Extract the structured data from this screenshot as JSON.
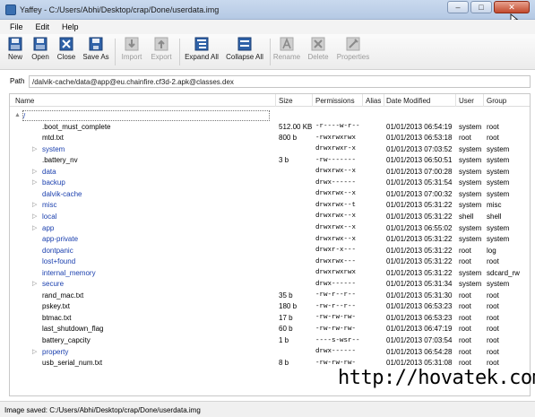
{
  "window": {
    "title": "Yaffey - C:/Users/Abhi/Desktop/crap/Done/userdata.img",
    "minimize_label": "–",
    "maximize_label": "□",
    "close_label": "✕"
  },
  "menu": {
    "items": [
      "File",
      "Edit",
      "Help"
    ]
  },
  "toolbar": {
    "buttons": [
      {
        "label": "New",
        "icon": "new-file-icon",
        "enabled": true
      },
      {
        "label": "Open",
        "icon": "open-icon",
        "enabled": true
      },
      {
        "label": "Close",
        "icon": "close-file-icon",
        "enabled": true
      },
      {
        "label": "Save As",
        "icon": "save-as-icon",
        "enabled": true
      },
      {
        "label": "Import",
        "icon": "import-icon",
        "enabled": false
      },
      {
        "label": "Export",
        "icon": "export-icon",
        "enabled": false
      },
      {
        "label": "Expand All",
        "icon": "expand-all-icon",
        "enabled": true
      },
      {
        "label": "Collapse All",
        "icon": "collapse-all-icon",
        "enabled": true
      },
      {
        "label": "Rename",
        "icon": "rename-icon",
        "enabled": false
      },
      {
        "label": "Delete",
        "icon": "delete-icon",
        "enabled": false
      },
      {
        "label": "Properties",
        "icon": "properties-icon",
        "enabled": false
      }
    ]
  },
  "path": {
    "label": "Path",
    "value": "/dalvik-cache/data@app@eu.chainfire.cf3d-2.apk@classes.dex"
  },
  "table": {
    "columns": [
      "Name",
      "Size",
      "Permissions",
      "Alias",
      "Date Modified",
      "User",
      "Group"
    ],
    "rows": [
      {
        "name": "/",
        "type": "root",
        "expander": "▲",
        "size": "",
        "perm": "",
        "date": "",
        "user": "",
        "group": ""
      },
      {
        "name": ".boot_must_complete",
        "type": "file",
        "size": "512.00 KB",
        "perm": "-r----w-r--",
        "date": "01/01/2013 06:54:19",
        "user": "system",
        "group": "root"
      },
      {
        "name": "mtd.txt",
        "type": "file",
        "size": "800 b",
        "perm": "-rwxrwxrwx",
        "date": "01/01/2013 06:53:18",
        "user": "root",
        "group": "root"
      },
      {
        "name": "system",
        "type": "dir",
        "expander": "▷",
        "size": "",
        "perm": "drwxrwxr-x",
        "date": "01/01/2013 07:03:52",
        "user": "system",
        "group": "system"
      },
      {
        "name": ".battery_nv",
        "type": "file",
        "size": "3 b",
        "perm": "-rw-------",
        "date": "01/01/2013 06:50:51",
        "user": "system",
        "group": "system"
      },
      {
        "name": "data",
        "type": "dir",
        "expander": "▷",
        "size": "",
        "perm": "drwxrwx--x",
        "date": "01/01/2013 07:00:28",
        "user": "system",
        "group": "system"
      },
      {
        "name": "backup",
        "type": "dir",
        "expander": "▷",
        "size": "",
        "perm": "drwx------",
        "date": "01/01/2013 05:31:54",
        "user": "system",
        "group": "system"
      },
      {
        "name": "dalvik-cache",
        "type": "dir",
        "size": "",
        "perm": "drwxrwx--x",
        "date": "01/01/2013 07:00:32",
        "user": "system",
        "group": "system"
      },
      {
        "name": "misc",
        "type": "dir",
        "expander": "▷",
        "size": "",
        "perm": "drwxrwx--t",
        "date": "01/01/2013 05:31:22",
        "user": "system",
        "group": "misc"
      },
      {
        "name": "local",
        "type": "dir",
        "expander": "▷",
        "size": "",
        "perm": "drwxrwx--x",
        "date": "01/01/2013 05:31:22",
        "user": "shell",
        "group": "shell"
      },
      {
        "name": "app",
        "type": "dir",
        "expander": "▷",
        "size": "",
        "perm": "drwxrwx--x",
        "date": "01/01/2013 06:55:02",
        "user": "system",
        "group": "system"
      },
      {
        "name": "app-private",
        "type": "dir",
        "size": "",
        "perm": "drwxrwx--x",
        "date": "01/01/2013 05:31:22",
        "user": "system",
        "group": "system"
      },
      {
        "name": "dontpanic",
        "type": "dir",
        "size": "",
        "perm": "drwxr-x---",
        "date": "01/01/2013 05:31:22",
        "user": "root",
        "group": "log"
      },
      {
        "name": "lost+found",
        "type": "dir",
        "size": "",
        "perm": "drwxrwx---",
        "date": "01/01/2013 05:31:22",
        "user": "root",
        "group": "root"
      },
      {
        "name": "internal_memory",
        "type": "dir",
        "size": "",
        "perm": "drwxrwxrwx",
        "date": "01/01/2013 05:31:22",
        "user": "system",
        "group": "sdcard_rw"
      },
      {
        "name": "secure",
        "type": "dir",
        "expander": "▷",
        "size": "",
        "perm": "drwx------",
        "date": "01/01/2013 05:31:34",
        "user": "system",
        "group": "system"
      },
      {
        "name": "rand_mac.txt",
        "type": "file",
        "size": "35 b",
        "perm": "-rw-r--r--",
        "date": "01/01/2013 05:31:30",
        "user": "root",
        "group": "root"
      },
      {
        "name": "pskey.txt",
        "type": "file",
        "size": "180 b",
        "perm": "-rw-r--r--",
        "date": "01/01/2013 06:53:23",
        "user": "root",
        "group": "root"
      },
      {
        "name": "btmac.txt",
        "type": "file",
        "size": "17 b",
        "perm": "-rw-rw-rw-",
        "date": "01/01/2013 06:53:23",
        "user": "root",
        "group": "root"
      },
      {
        "name": "last_shutdown_flag",
        "type": "file",
        "size": "60 b",
        "perm": "-rw-rw-rw-",
        "date": "01/01/2013 06:47:19",
        "user": "root",
        "group": "root"
      },
      {
        "name": "battery_capcity",
        "type": "file",
        "size": "1 b",
        "perm": "----s-wsr--",
        "date": "01/01/2013 07:03:54",
        "user": "root",
        "group": "root"
      },
      {
        "name": "property",
        "type": "dir",
        "expander": "▷",
        "size": "",
        "perm": "drwx------",
        "date": "01/01/2013 06:54:28",
        "user": "root",
        "group": "root"
      },
      {
        "name": "usb_serial_num.txt",
        "type": "file",
        "size": "8 b",
        "perm": "-rw-rw-rw-",
        "date": "01/01/2013 05:31:08",
        "user": "root",
        "group": "root"
      }
    ]
  },
  "status": {
    "text": "Image saved: C:/Users/Abhi/Desktop/crap/Done/userdata.img"
  },
  "watermark": {
    "text": "http://hovatek.com"
  },
  "colors": {
    "dir_name": "#1a3fae",
    "titlebar": "#c9d9ee"
  }
}
